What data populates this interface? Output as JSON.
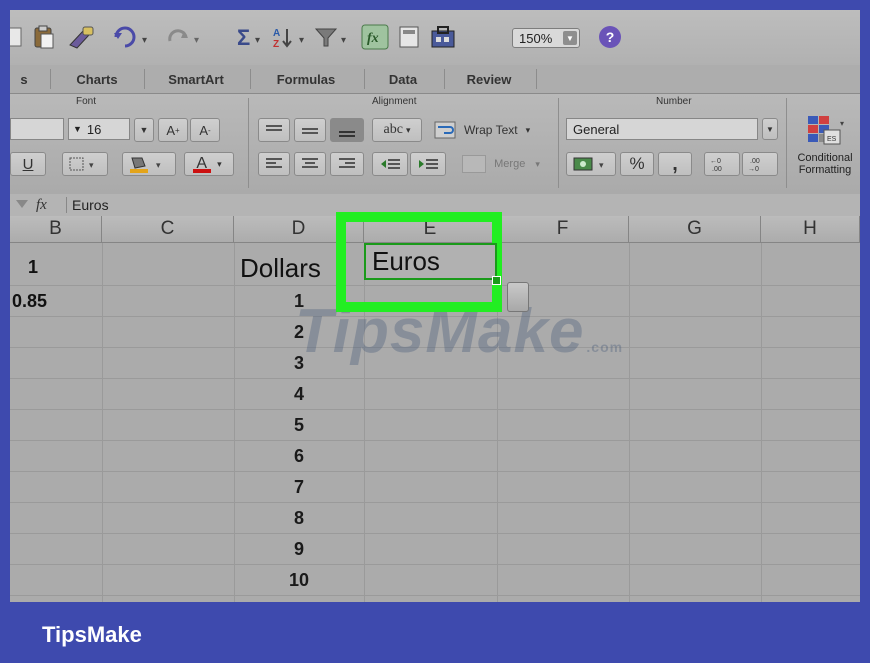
{
  "toolbar": {
    "zoom": "150%",
    "help": "?",
    "icons": [
      "paste-icon",
      "format-painter-icon",
      "undo-icon",
      "redo-icon",
      "autosum-icon",
      "sort-icon",
      "filter-icon",
      "function-icon",
      "gallery-icon",
      "toolbox-icon",
      "help-icon"
    ]
  },
  "tabs": [
    {
      "label": "s"
    },
    {
      "label": "Charts"
    },
    {
      "label": "SmartArt"
    },
    {
      "label": "Formulas"
    },
    {
      "label": "Data"
    },
    {
      "label": "Review"
    }
  ],
  "ribbon": {
    "font_group": "Font",
    "font_size": "16",
    "grow_font": "A",
    "shrink_font": "A",
    "underline": "U",
    "font_color_letter": "A",
    "alignment_group": "Alignment",
    "abc": "abc",
    "wrap_text": "Wrap Text",
    "merge": "Merge",
    "number_group": "Number",
    "number_format": "General",
    "percent": "%",
    "comma": ",",
    "conditional_formatting": "Conditional Formatting",
    "conditional_line1": "Conditional",
    "conditional_line2": "Formatting",
    "fill_color": "#e3a41a",
    "font_color": "#cc1111"
  },
  "formula_bar": {
    "fx": "fx",
    "value": "Euros"
  },
  "columns": [
    "B",
    "C",
    "D",
    "E",
    "F",
    "G",
    "H"
  ],
  "cells": {
    "b1": "1",
    "b2": "0.85",
    "d1": "Dollars",
    "e1": "Euros",
    "d_values": [
      "1",
      "2",
      "3",
      "4",
      "5",
      "6",
      "7",
      "8",
      "9",
      "10"
    ]
  },
  "highlight_color": "#22ee22",
  "watermark": {
    "text": "TipsMake",
    "suffix": ".com"
  },
  "footer": {
    "brand": "TipsMake"
  }
}
